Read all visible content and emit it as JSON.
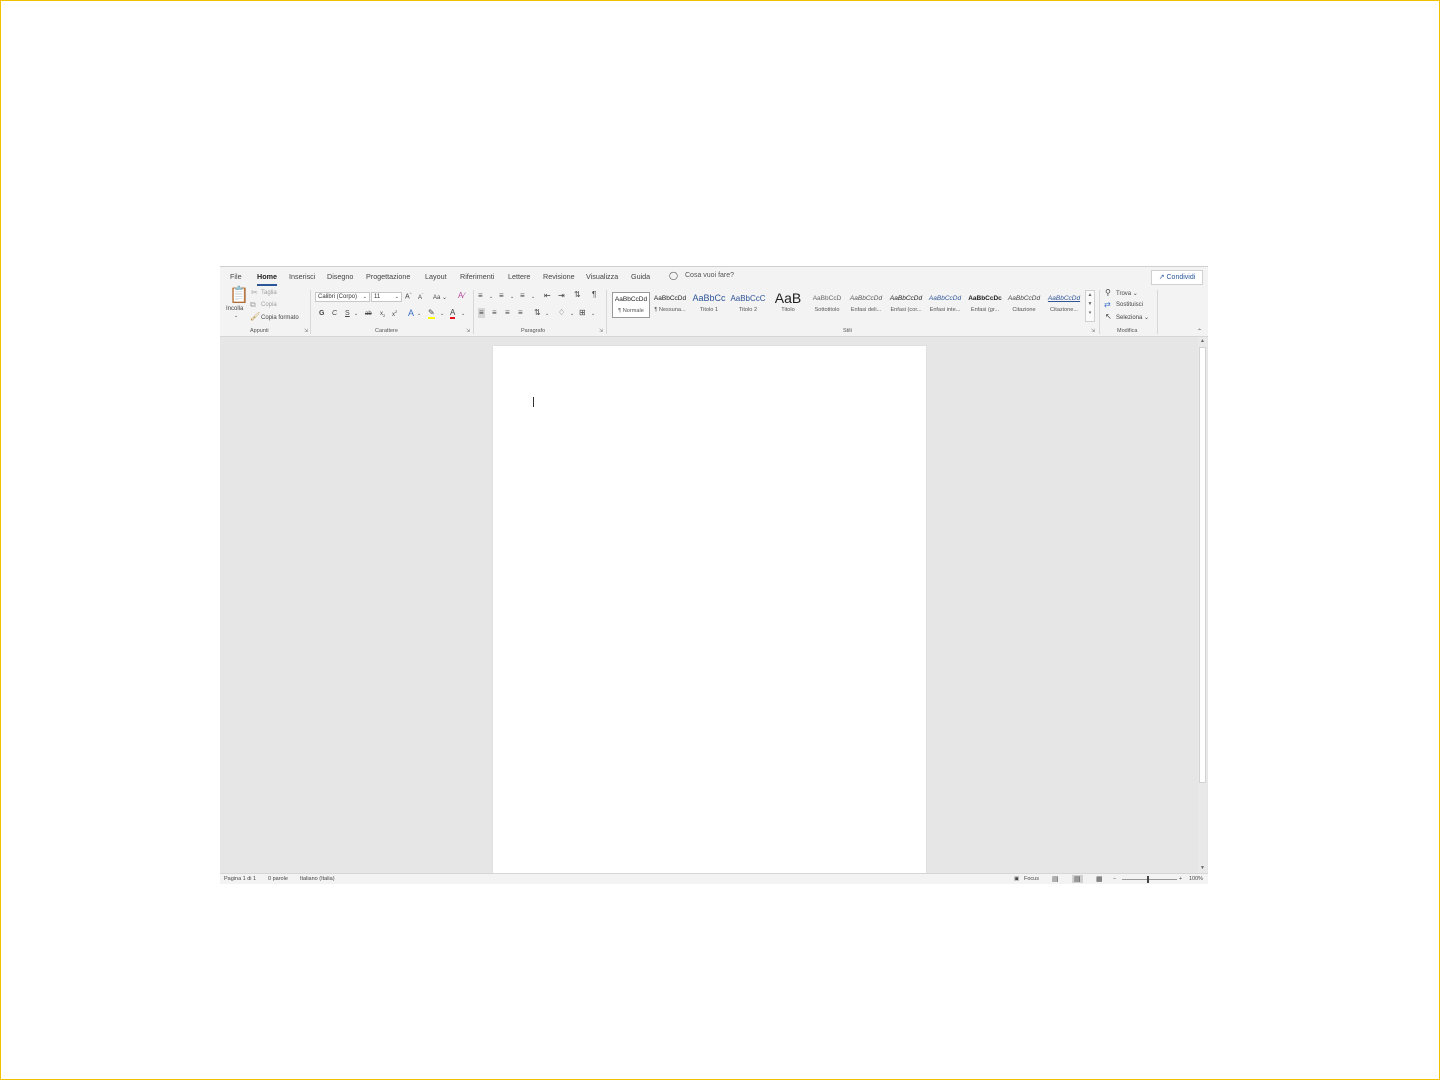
{
  "tabs": [
    "File",
    "Home",
    "Inserisci",
    "Disegno",
    "Progettazione",
    "Layout",
    "Riferimenti",
    "Lettere",
    "Revisione",
    "Visualizza",
    "Guida"
  ],
  "tellme": "Cosa vuoi fare?",
  "share": "Condividi",
  "clipboard": {
    "paste": "Incolla",
    "cut": "Taglia",
    "copy": "Copia",
    "format_painter": "Copia formato",
    "label": "Appunti"
  },
  "font": {
    "name": "Calibri (Corpo)",
    "size": "11",
    "change_case": "Aa",
    "bold": "G",
    "italic": "C",
    "underline": "S",
    "label": "Carattere"
  },
  "paragraph": {
    "label": "Paragrafo"
  },
  "styles": {
    "label": "Stili",
    "items": [
      {
        "preview": "AaBbCcDd",
        "name": "¶ Normale"
      },
      {
        "preview": "AaBbCcDd",
        "name": "¶ Nessuna..."
      },
      {
        "preview": "AaBbCc",
        "name": "Titolo 1"
      },
      {
        "preview": "AaBbCcC",
        "name": "Titolo 2"
      },
      {
        "preview": "AaB",
        "name": "Titolo"
      },
      {
        "preview": "AaBbCcD",
        "name": "Sottotitolo"
      },
      {
        "preview": "AaBbCcDd",
        "name": "Enfasi deli..."
      },
      {
        "preview": "AaBbCcDd",
        "name": "Enfasi (cor..."
      },
      {
        "preview": "AaBbCcDd",
        "name": "Enfasi inte..."
      },
      {
        "preview": "AaBbCcDc",
        "name": "Enfasi (gr..."
      },
      {
        "preview": "AaBbCcDd",
        "name": "Citazione"
      },
      {
        "preview": "AaBbCcDd",
        "name": "Citazione..."
      }
    ]
  },
  "editing": {
    "find": "Trova",
    "replace": "Sostituisci",
    "select": "Seleziona",
    "label": "Modifica"
  },
  "status": {
    "page": "Pagina 1 di 1",
    "words": "0 parole",
    "language": "Italiano (Italia)",
    "focus": "Focus",
    "zoom_out": "−",
    "zoom_in": "+",
    "zoom": "100%"
  },
  "colors": {
    "accent": "#2b579a",
    "highlight": "#ffff00",
    "font_color": "#e81123",
    "page_bg": "#ffffff",
    "canvas_bg": "#e6e6e6",
    "frame": "#f2c200"
  }
}
